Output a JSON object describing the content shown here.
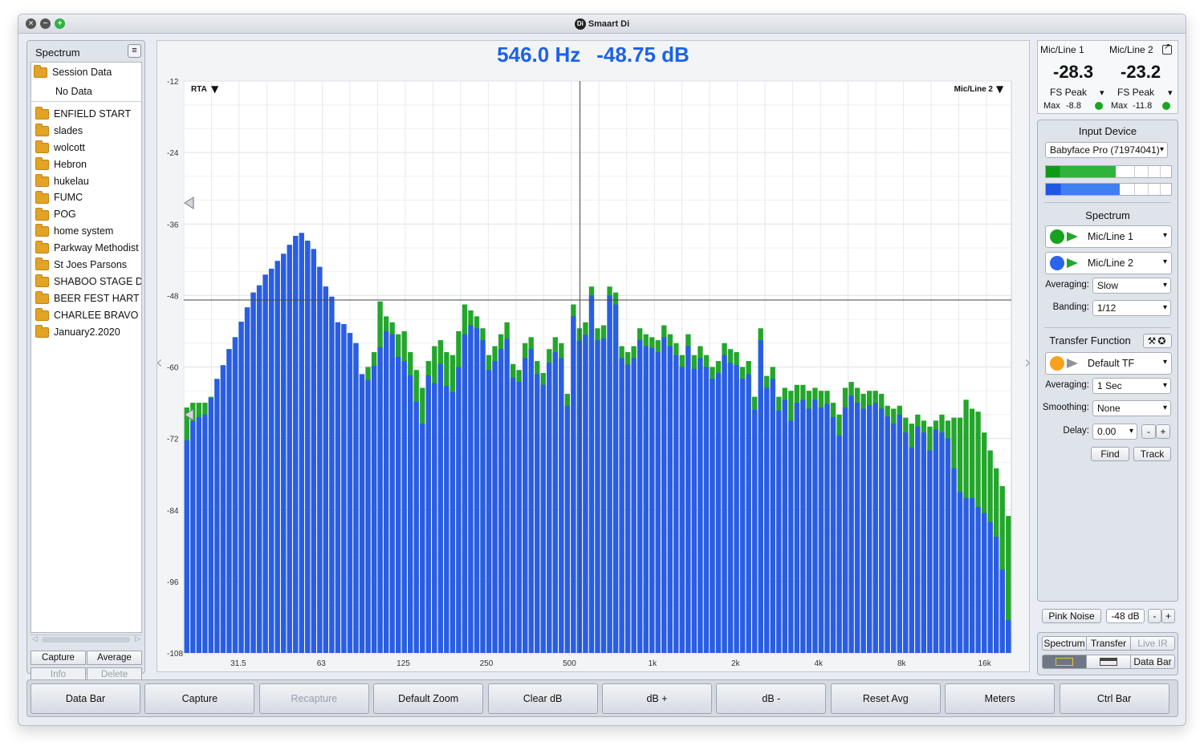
{
  "window": {
    "title": "Smaart Di",
    "logo": "Di"
  },
  "left_panel": {
    "title": "Spectrum",
    "session_label": "Session Data",
    "no_data": "No Data",
    "folders": [
      "ENFIELD START",
      "slades",
      "wolcott",
      "Hebron",
      "hukelau",
      "FUMC",
      "POG",
      "home system",
      "Parkway Methodist",
      "St Joes Parsons",
      "SHABOO STAGE D",
      "BEER FEST HART",
      "CHARLEE BRAVO",
      "January2.2020"
    ],
    "buttons": {
      "capture": "Capture",
      "average": "Average",
      "info": "Info",
      "delete": "Delete"
    }
  },
  "readout": {
    "freq": "546.0 Hz",
    "level": "-48.75 dB"
  },
  "chart_data": {
    "type": "bar",
    "mode_label": "RTA",
    "trace_label": "Mic/Line 2",
    "x_scale": "log",
    "x_tick_labels": [
      "31.5",
      "63",
      "125",
      "250",
      "500",
      "1k",
      "2k",
      "4k",
      "8k",
      "16k"
    ],
    "y_tick_labels": [
      "-12",
      "-24",
      "-36",
      "-48",
      "-60",
      "-72",
      "-84",
      "-96",
      "-108"
    ],
    "ylim": [
      -108,
      -12
    ],
    "band_start_hz": 20,
    "banding": "1/12",
    "cursor": {
      "x_hz": 546.0,
      "y_db": -48.75
    },
    "series": [
      {
        "name": "Mic/Line 2",
        "color": "#2b5ce6",
        "values": [
          -72.3,
          -69.1,
          -68.4,
          -68.0,
          -65.2,
          -62.0,
          -59.7,
          -57.0,
          -55.0,
          -52.4,
          -50.0,
          -47.5,
          -46.3,
          -44.5,
          -43.5,
          -42.2,
          -41.0,
          -39.5,
          -38.0,
          -37.5,
          -38.8,
          -40.2,
          -43.2,
          -46.5,
          -48.2,
          -52.5,
          -52.8,
          -54.3,
          -56.0,
          -61.2,
          -62.2,
          -59.8,
          -56.7,
          -54.0,
          -54.5,
          -58.3,
          -59.0,
          -61.4,
          -65.8,
          -69.5,
          -61.4,
          -62.7,
          -59.5,
          -63.2,
          -64.2,
          -60.0,
          -54.5,
          -53.0,
          -53.5,
          -55.5,
          -60.5,
          -59.0,
          -57.0,
          -55.3,
          -61.8,
          -62.5,
          -58.5,
          -57.0,
          -61.2,
          -63.0,
          -59.3,
          -57.5,
          -58.5,
          -66.5,
          -51.5,
          -55.6,
          -54.6,
          -48.0,
          -55.5,
          -55.2,
          -48.0,
          -49.5,
          -58.5,
          -59.6,
          -58.5,
          -55.5,
          -56.5,
          -56.8,
          -57.5,
          -55.0,
          -56.5,
          -58.0,
          -60.0,
          -56.5,
          -60.3,
          -58.5,
          -60.0,
          -62.0,
          -61.0,
          -58.0,
          -59.3,
          -59.7,
          -62.0,
          -61.2,
          -67.2,
          -55.5,
          -63.5,
          -62.0,
          -67.3,
          -65.5,
          -69.0,
          -66.0,
          -65.5,
          -67.0,
          -65.5,
          -66.8,
          -66.2,
          -68.4,
          -71.5,
          -66.8,
          -64.8,
          -66.0,
          -67.0,
          -66.4,
          -66.0,
          -67.0,
          -68.3,
          -69.5,
          -68.0,
          -71.0,
          -73.5,
          -70.0,
          -71.0,
          -74.0,
          -70.5,
          -71.0,
          -72.0,
          -77.0,
          -81.0,
          -82.0,
          -82.0,
          -83.5,
          -84.5,
          -86.0,
          -88.5,
          -94.0,
          -102.5
        ]
      },
      {
        "name": "Mic/Line 1",
        "color": "#23a62b",
        "values": [
          -66.8,
          -66.0,
          -66.0,
          -66.0,
          -65.0,
          -62.0,
          -59.7,
          -57.0,
          -55.0,
          -52.4,
          -50.0,
          -47.5,
          -46.3,
          -44.5,
          -43.5,
          -42.2,
          -41.0,
          -39.5,
          -38.0,
          -37.5,
          -38.8,
          -40.2,
          -43.2,
          -46.5,
          -48.2,
          -52.5,
          -52.8,
          -54.3,
          -56.0,
          -61.2,
          -60.0,
          -57.5,
          -49.0,
          -51.5,
          -52.5,
          -54.5,
          -54.0,
          -57.5,
          -60.5,
          -63.5,
          -59.0,
          -56.5,
          -55.5,
          -57.5,
          -58.0,
          -54.0,
          -49.5,
          -50.5,
          -51.5,
          -53.5,
          -58.0,
          -56.5,
          -54.5,
          -52.5,
          -59.5,
          -60.5,
          -56.0,
          -55.0,
          -59.0,
          -61.0,
          -57.0,
          -55.0,
          -56.0,
          -64.5,
          -49.5,
          -53.5,
          -52.5,
          -46.5,
          -53.5,
          -53.0,
          -46.5,
          -47.5,
          -56.5,
          -57.5,
          -56.5,
          -53.5,
          -54.5,
          -55.0,
          -55.5,
          -53.0,
          -54.5,
          -56.0,
          -58.0,
          -54.5,
          -58.0,
          -56.5,
          -58.0,
          -60.0,
          -59.0,
          -56.0,
          -57.0,
          -57.5,
          -60.0,
          -59.0,
          -65.0,
          -53.5,
          -61.5,
          -60.0,
          -65.0,
          -63.5,
          -64.0,
          -63.0,
          -63.0,
          -64.0,
          -63.5,
          -64.0,
          -64.0,
          -66.0,
          -68.0,
          -63.5,
          -62.5,
          -63.5,
          -64.5,
          -64.0,
          -64.0,
          -64.5,
          -66.5,
          -67.0,
          -66.5,
          -68.5,
          -69.5,
          -68.0,
          -69.0,
          -70.0,
          -69.0,
          -68.0,
          -69.0,
          -68.5,
          -68.5,
          -65.5,
          -67.0,
          -67.5,
          -71.0,
          -74.0,
          -77.0,
          -80.0,
          -85.0
        ]
      }
    ]
  },
  "meters": {
    "ch1": {
      "name": "Mic/Line 1",
      "value": "-28.3",
      "mode": "FS Peak",
      "max_label": "Max",
      "max_value": "-8.8"
    },
    "ch2": {
      "name": "Mic/Line 2",
      "value": "-23.2",
      "mode": "FS Peak",
      "max_label": "Max",
      "max_value": "-11.8"
    }
  },
  "control": {
    "input_device_title": "Input Device",
    "input_device": "Babyface Pro (71974041)",
    "level_bars": [
      {
        "color_dark": "#0e9a16",
        "color": "#2fb33a",
        "fraction": 0.56
      },
      {
        "color_dark": "#1f56e2",
        "color": "#3f7ff0",
        "fraction": 0.59
      }
    ],
    "spectrum_title": "Spectrum",
    "spectrum_measurements": [
      {
        "name": "Mic/Line 1",
        "color": "#18a31f"
      },
      {
        "name": "Mic/Line 2",
        "color": "#2b63ea"
      }
    ],
    "averaging_label": "Averaging:",
    "averaging": "Slow",
    "banding_label": "Banding:",
    "banding": "1/12",
    "tf_title": "Transfer Function",
    "tf_measurement": {
      "name": "Default TF",
      "color": "#f7a11e"
    },
    "tf_averaging_label": "Averaging:",
    "tf_averaging": "1 Sec",
    "smoothing_label": "Smoothing:",
    "smoothing": "None",
    "delay_label": "Delay:",
    "delay": "0.00",
    "find": "Find",
    "track": "Track",
    "pink_noise": "Pink Noise",
    "pink_level": "-48 dB",
    "minus": "-",
    "plus": "+",
    "tabs": [
      "Spectrum",
      "Transfer",
      "Live IR"
    ],
    "data_bar": "Data Bar"
  },
  "toolbar": [
    "Data Bar",
    "Capture",
    "Recapture",
    "Default Zoom",
    "Clear dB",
    "dB +",
    "dB -",
    "Reset Avg",
    "Meters",
    "Ctrl Bar"
  ]
}
